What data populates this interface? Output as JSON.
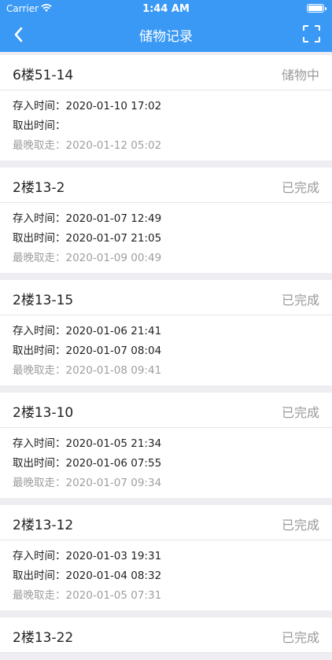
{
  "status_bar": {
    "carrier": "Carrier",
    "time": "1:44 AM"
  },
  "nav": {
    "title": "储物记录"
  },
  "labels": {
    "deposit": "存入时间：",
    "retrieve": "取出时间：",
    "latest": "最晚取走："
  },
  "records": [
    {
      "title": "6楼51-14",
      "status": "储物中",
      "deposit": "2020-01-10 17:02",
      "retrieve": "",
      "latest": "2020-01-12 05:02"
    },
    {
      "title": "2楼13-2",
      "status": "已完成",
      "deposit": "2020-01-07 12:49",
      "retrieve": "2020-01-07 21:05",
      "latest": "2020-01-09 00:49"
    },
    {
      "title": "2楼13-15",
      "status": "已完成",
      "deposit": "2020-01-06 21:41",
      "retrieve": "2020-01-07 08:04",
      "latest": "2020-01-08 09:41"
    },
    {
      "title": "2楼13-10",
      "status": "已完成",
      "deposit": "2020-01-05 21:34",
      "retrieve": "2020-01-06 07:55",
      "latest": "2020-01-07 09:34"
    },
    {
      "title": "2楼13-12",
      "status": "已完成",
      "deposit": "2020-01-03 19:31",
      "retrieve": "2020-01-04 08:32",
      "latest": "2020-01-05 07:31"
    },
    {
      "title": "2楼13-22",
      "status": "已完成",
      "deposit": "",
      "retrieve": "",
      "latest": ""
    }
  ],
  "colors": {
    "accent": "#3a99f5",
    "background": "#ededf2",
    "muted": "#9e9e9e"
  }
}
